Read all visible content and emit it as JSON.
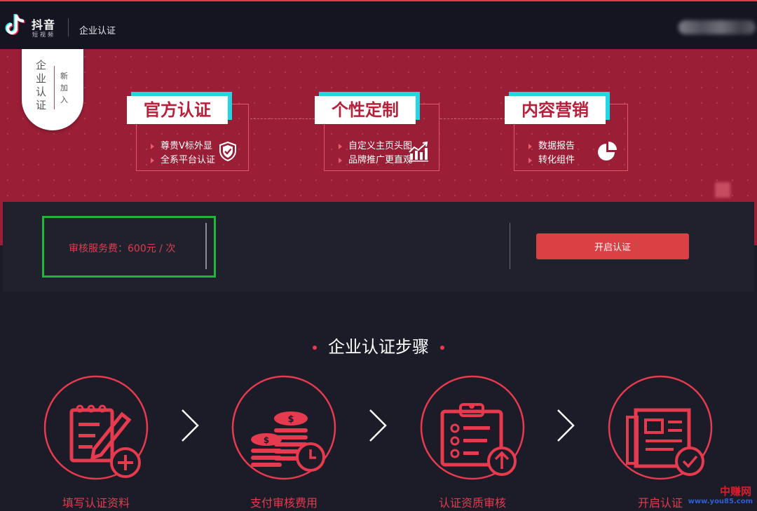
{
  "header": {
    "logo_text": "抖音",
    "logo_sub": "短视频",
    "page_title": "企业认证"
  },
  "badge": {
    "main": "企业认证",
    "side": "新加入"
  },
  "features": [
    {
      "title": "官方认证",
      "items": [
        "尊贵V标外显",
        "全系平台认证"
      ],
      "icon": "shield-check-icon"
    },
    {
      "title": "个性定制",
      "items": [
        "自定义主页头图",
        "品牌推广更直观"
      ],
      "icon": "bar-chart-trend-icon"
    },
    {
      "title": "内容营销",
      "items": [
        "数据报告",
        "转化组件"
      ],
      "icon": "pie-chart-icon"
    }
  ],
  "fee": {
    "text": "审核服务费：600元 / 次"
  },
  "cta_label": "开启认证",
  "steps": {
    "title": "企业认证步骤",
    "items": [
      {
        "label": "填写认证资料",
        "icon": "form-edit-add-icon"
      },
      {
        "label": "支付审核费用",
        "icon": "coins-clock-icon"
      },
      {
        "label": "认证资质审核",
        "icon": "clipboard-upload-icon"
      },
      {
        "label": "开启认证",
        "icon": "document-check-icon"
      }
    ]
  },
  "watermark": {
    "cn": "中赚网",
    "url": "www.you85.com"
  },
  "colors": {
    "accent": "#e63a4e",
    "banner": "#991e36",
    "cyan_shadow": "#23d7e2",
    "highlight_green": "#1fb538",
    "button": "#d94144"
  }
}
